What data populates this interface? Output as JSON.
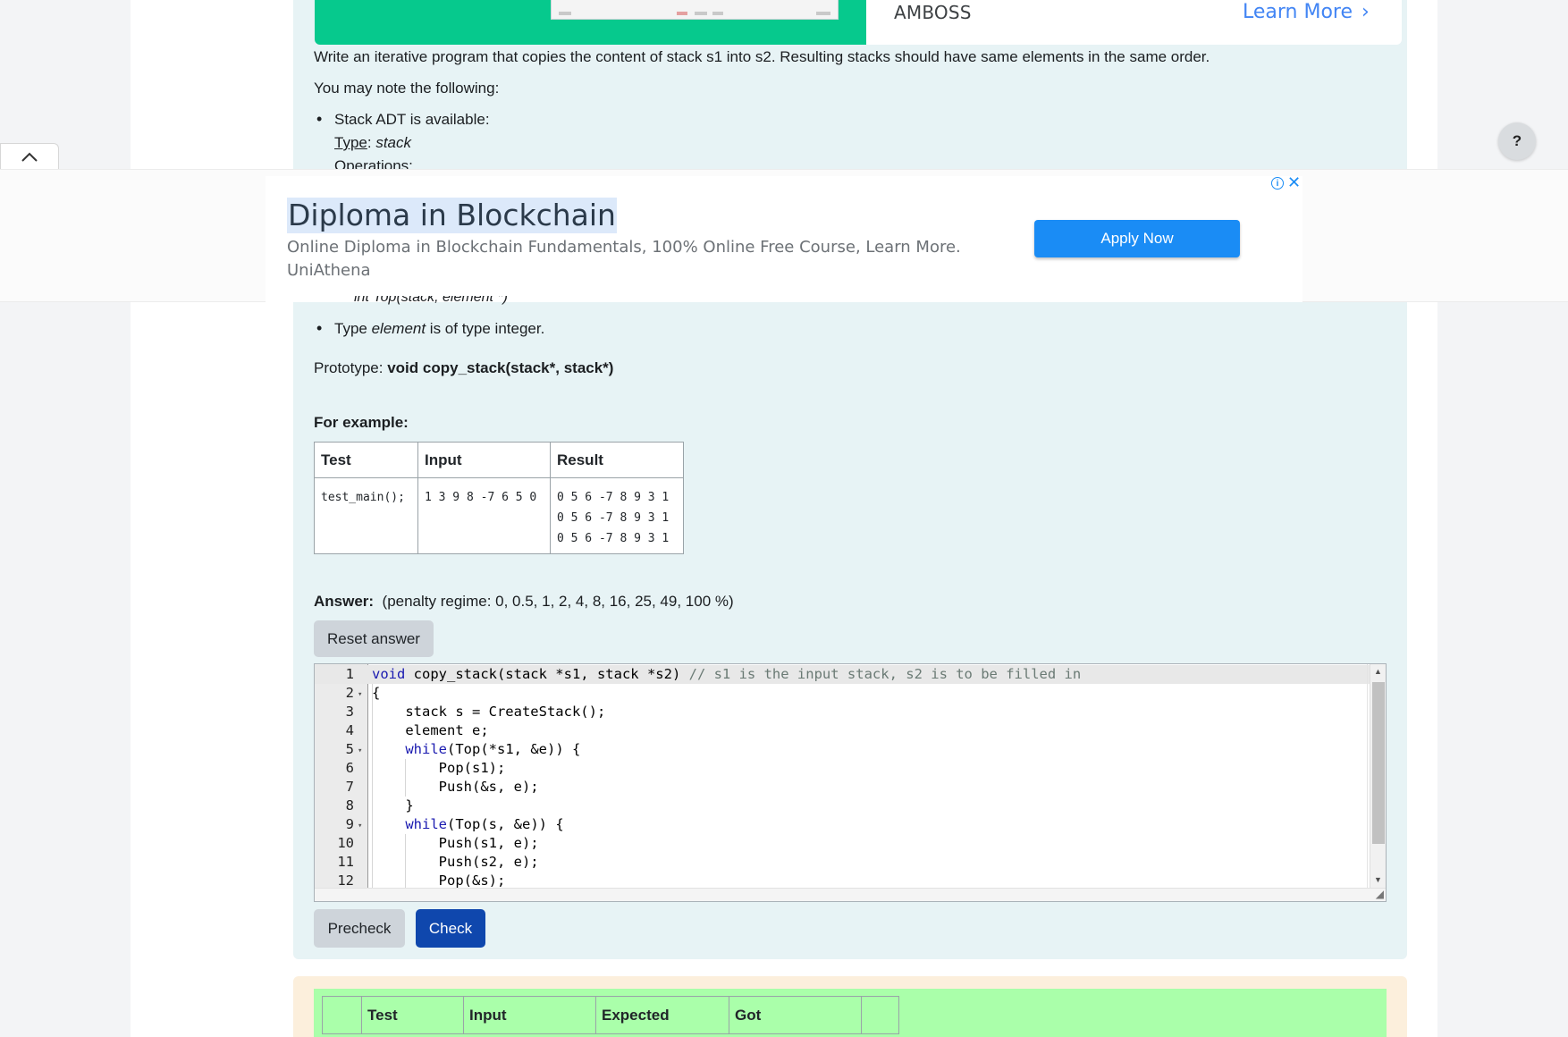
{
  "top_ad": {
    "advertiser": "AMBOSS",
    "cta": "Learn More"
  },
  "question": {
    "instruction": "Write an iterative program that copies the content of stack s1 into s2. Resulting stacks should have same elements in the same order.",
    "note_intro": "You may note the following:",
    "bullet_adt": "Stack ADT is available:",
    "type_label": "Type",
    "type_sep": ": ",
    "type_value": "stack",
    "operations_label": "Operations:",
    "op_top": "int Top(stack, element *)",
    "bullet_element_pre": "Type ",
    "bullet_element_em": "element",
    "bullet_element_post": " is of type integer.",
    "prototype_label": "Prototype: ",
    "prototype_value": "void copy_stack(stack*, stack*)",
    "example_heading": "For example:",
    "example_table": {
      "headers": [
        "Test",
        "Input",
        "Result"
      ],
      "rows": [
        {
          "test": "test_main();",
          "input": "1 3 9 8 -7 6 5 0",
          "result": "0 5 6 -7 8 9 3 1\n0 5 6 -7 8 9 3 1\n0 5 6 -7 8 9 3 1"
        }
      ]
    },
    "answer_label": "Answer:",
    "penalty_text": "(penalty regime: 0, 0.5, 1, 2, 4, 8, 16, 25, 49, 100 %)",
    "reset_label": "Reset answer"
  },
  "ad": {
    "title": "Diploma in Blockchain",
    "description": "Online Diploma in Blockchain Fundamentals, 100% Online Free Course, Learn More.",
    "brand": "UniAthena",
    "cta": "Apply Now",
    "info_icon": "info-icon",
    "close_icon": "close-icon"
  },
  "help": {
    "label": "?"
  },
  "editor": {
    "lines": [
      {
        "n": "1",
        "fold": "",
        "src": "<span class=\"kw\">void</span> copy_stack(stack *s1, stack *s2) <span class=\"cm\">// s1 is the input stack, s2 is to be filled in</span>"
      },
      {
        "n": "2",
        "fold": "▾",
        "src": "{"
      },
      {
        "n": "3",
        "fold": "",
        "src": "    stack s = CreateStack();"
      },
      {
        "n": "4",
        "fold": "",
        "src": "    element e;"
      },
      {
        "n": "5",
        "fold": "▾",
        "src": "    <span class=\"kw\">while</span>(Top(*s1, &amp;e)) {"
      },
      {
        "n": "6",
        "fold": "",
        "src": "        Pop(s1);"
      },
      {
        "n": "7",
        "fold": "",
        "src": "        Push(&amp;s, e);"
      },
      {
        "n": "8",
        "fold": "",
        "src": "    }"
      },
      {
        "n": "9",
        "fold": "▾",
        "src": "    <span class=\"kw\">while</span>(Top(s, &amp;e)) {"
      },
      {
        "n": "10",
        "fold": "",
        "src": "        Push(s1, e);"
      },
      {
        "n": "11",
        "fold": "",
        "src": "        Push(s2, e);"
      },
      {
        "n": "12",
        "fold": "",
        "src": "        Pop(&amp;s);"
      }
    ]
  },
  "buttons": {
    "precheck": "Precheck",
    "check": "Check"
  },
  "result_table": {
    "headers": [
      "",
      "Test",
      "Input",
      "Expected",
      "Got",
      ""
    ]
  },
  "colors": {
    "question_bg": "#e7f3f5",
    "primary": "#0f47ad",
    "ad_button": "#1a8cf5",
    "result_panel": "#fcefdc",
    "result_pass": "#aaffaa",
    "top_ad_image": "#06c98d"
  }
}
